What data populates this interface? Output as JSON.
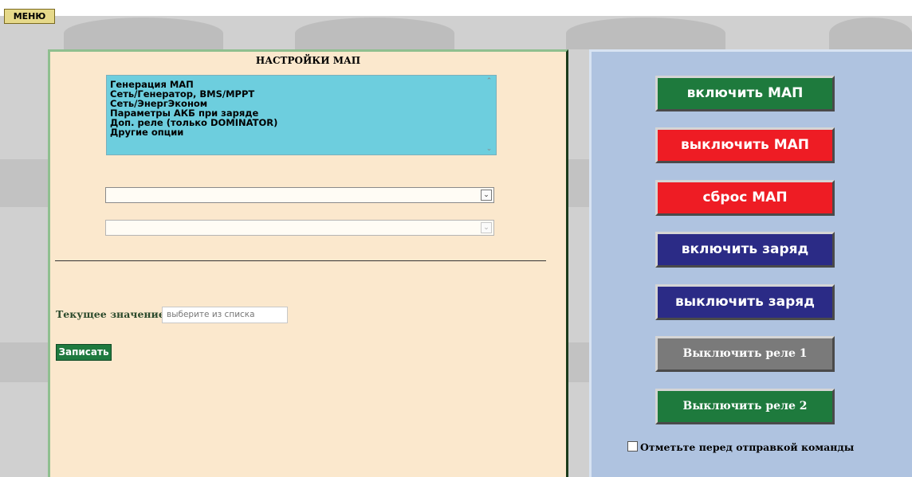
{
  "menu": {
    "label": "МЕНЮ"
  },
  "settings": {
    "title": "НАСТРОЙКИ МАП",
    "list_options": [
      "Генерация МАП",
      "Сеть/Генератор, BMS/MPPT",
      "Сеть/ЭнергЭконом",
      "Параметры АКБ при заряде",
      "Доп. реле (только DOMINATOR)",
      "Другие опции"
    ],
    "select1_value": "",
    "select2_value": "",
    "current_label": "Текущее значение:",
    "current_placeholder": "выберите из списка",
    "write_label": "Записать"
  },
  "commands": {
    "map_on": "включить МАП",
    "map_off": "выключить МАП",
    "map_reset": "сброс МАП",
    "charge_on": "включить заряд",
    "charge_off": "выключить заряд",
    "relay1_off": "Выключить реле 1",
    "relay2_off": "Выключить реле 2",
    "confirm_label": "Отметьте перед отправкой команды"
  },
  "colors": {
    "green": "#1e7a3d",
    "red": "#ee1c24",
    "navy": "#2b2b86",
    "gray": "#7a7a7a",
    "left_panel": "#fbe8cd",
    "right_panel": "#afc3e0",
    "listbox": "#6dcede"
  },
  "icons": {
    "scroll_up": "up-arrow-icon",
    "scroll_down": "down-arrow-icon",
    "dropdown": "chevron-down-icon"
  }
}
